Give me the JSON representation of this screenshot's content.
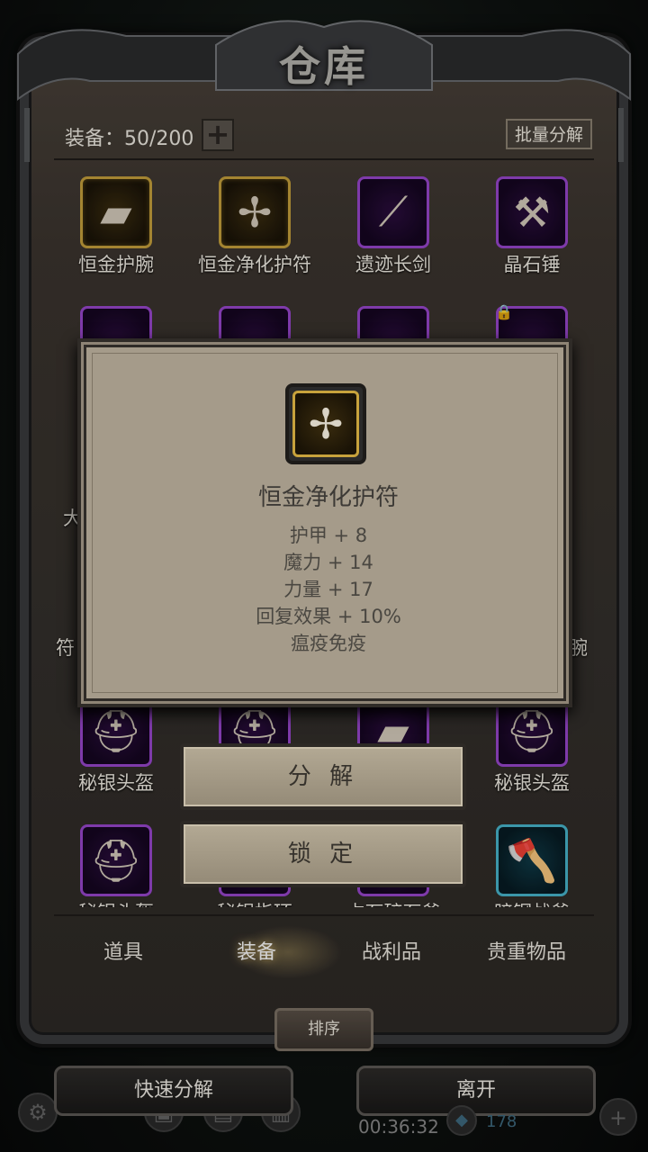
{
  "header": {
    "title": "仓库"
  },
  "inventory": {
    "capacity_label": "装备：50/200",
    "add_symbol": "+",
    "batch_button": "批量分解"
  },
  "items": [
    {
      "name": "恒金护腕",
      "rarity": "gold",
      "icon": "bracer-icon"
    },
    {
      "name": "恒金净化护符",
      "rarity": "gold",
      "icon": "amulet-icon"
    },
    {
      "name": "遗迹长剑",
      "rarity": "purple",
      "icon": "sword-icon"
    },
    {
      "name": "晶石锤",
      "rarity": "purple",
      "icon": "hammer-icon"
    },
    {
      "name": "大",
      "rarity": "purple",
      "icon": "item-icon"
    },
    {
      "name": "",
      "rarity": "purple",
      "icon": "item-icon"
    },
    {
      "name": "",
      "rarity": "purple",
      "icon": "item-icon"
    },
    {
      "name": "",
      "rarity": "purple",
      "icon": "item-icon",
      "locked": true
    },
    {
      "name": "符",
      "rarity": "purple",
      "icon": "item-icon"
    },
    {
      "name": "腕",
      "rarity": "purple",
      "icon": "item-icon"
    },
    {
      "name": "秘银头盔",
      "rarity": "purple",
      "icon": "helmet-icon"
    },
    {
      "name": "",
      "rarity": "purple",
      "icon": "helmet-icon"
    },
    {
      "name": "",
      "rarity": "purple",
      "icon": "bracer-icon"
    },
    {
      "name": "秘银头盔",
      "rarity": "purple",
      "icon": "helmet-icon"
    },
    {
      "name": "秘银头盔",
      "rarity": "purple",
      "icon": "helmet-icon"
    },
    {
      "name": "秘银指环",
      "rarity": "purple",
      "icon": "ring-icon"
    },
    {
      "name": "占石碎石斧",
      "rarity": "purple",
      "icon": "axe-icon"
    },
    {
      "name": "暗钢战斧",
      "rarity": "blue",
      "icon": "axe-icon"
    }
  ],
  "tabs": [
    {
      "label": "道具",
      "active": false
    },
    {
      "label": "装备",
      "active": true
    },
    {
      "label": "战利品",
      "active": false
    },
    {
      "label": "贵重物品",
      "active": false
    }
  ],
  "sort_button": "排序",
  "bottom": {
    "quick_decompose": "快速分解",
    "leave": "离开",
    "timer": "00:36:32",
    "gems": "178"
  },
  "popup": {
    "item_name": "恒金净化护符",
    "icon": "amulet-icon",
    "stats": [
      "护甲 + 8",
      "魔力 + 14",
      "力量 + 17",
      "回复效果 + 10%",
      "瘟疫免疫"
    ],
    "decompose_button": "分 解",
    "lock_button": "锁 定"
  },
  "colors": {
    "gold": "#c7a23c",
    "purple": "#9a47d0",
    "blue": "#48b7cf",
    "panel": "#a59b8a"
  }
}
